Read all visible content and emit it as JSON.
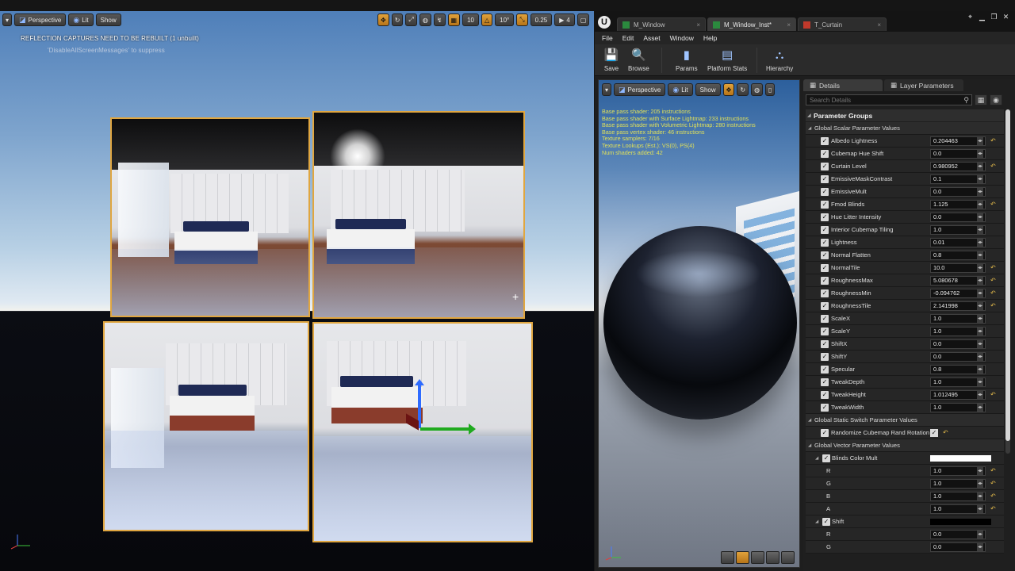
{
  "main_viewport": {
    "toolbar": {
      "view_mode": "Perspective",
      "lit_mode": "Lit",
      "show_label": "Show",
      "grid_snap": "10",
      "rotation_snap": "10°",
      "scale_snap": "0.25",
      "camera_speed": "4"
    },
    "messages": {
      "reflection_warning": "REFLECTION CAPTURES NEED TO BE REBUILT (1 unbuilt)",
      "suppress_hint": "'DisableAllScreenMessages' to suppress"
    }
  },
  "editor": {
    "tabs": [
      {
        "label": "M_Window"
      },
      {
        "label": "M_Window_Inst*"
      },
      {
        "label": "T_Curtain"
      }
    ],
    "menu": [
      "File",
      "Edit",
      "Asset",
      "Window",
      "Help"
    ],
    "toolbar": {
      "save": "Save",
      "browse": "Browse",
      "params": "Params",
      "platform_stats": "Platform Stats",
      "hierarchy": "Hierarchy"
    },
    "preview": {
      "toolbar": {
        "view_mode": "Perspective",
        "lit_mode": "Lit",
        "show_label": "Show"
      },
      "stats": [
        "Base pass shader: 205 instructions",
        "Base pass shader with Surface Lightmap: 233 instructions",
        "Base pass shader with Volumetric Lightmap: 280 instructions",
        "Base pass vertex shader: 46 instructions",
        "Texture samplers: 7/16",
        "Texture Lookups (Est.): VS(0), PS(4)",
        "Num shaders added: 42"
      ]
    },
    "details": {
      "tabs": {
        "details": "Details",
        "layer_parameters": "Layer Parameters"
      },
      "search_placeholder": "Search Details",
      "parameter_groups": "Parameter Groups",
      "scalar_group": "Global Scalar Parameter Values",
      "scalar_params": [
        {
          "name": "Albedo Lightness",
          "value": "0.204463",
          "overridden": true
        },
        {
          "name": "Cubemap Hue Shift",
          "value": "0.0",
          "overridden": false
        },
        {
          "name": "Curtain Level",
          "value": "0.980952",
          "overridden": true
        },
        {
          "name": "EmissiveMaskContrast",
          "value": "0.1",
          "overridden": false
        },
        {
          "name": "EmissiveMult",
          "value": "0.0",
          "overridden": false
        },
        {
          "name": "Fmod Blinds",
          "value": "1.125",
          "overridden": true
        },
        {
          "name": "Hue Litter Intensity",
          "value": "0.0",
          "overridden": false
        },
        {
          "name": "Interior Cubemap Tiling",
          "value": "1.0",
          "overridden": false
        },
        {
          "name": "Lightness",
          "value": "0.01",
          "overridden": false
        },
        {
          "name": "Normal Flatten",
          "value": "0.8",
          "overridden": false
        },
        {
          "name": "NormalTile",
          "value": "10.0",
          "overridden": true
        },
        {
          "name": "RoughnessMax",
          "value": "5.080678",
          "overridden": true
        },
        {
          "name": "RoughnessMin",
          "value": "-0.094762",
          "overridden": true
        },
        {
          "name": "RoughnessTile",
          "value": "2.141998",
          "overridden": true
        },
        {
          "name": "ScaleX",
          "value": "1.0",
          "overridden": false
        },
        {
          "name": "ScaleY",
          "value": "1.0",
          "overridden": false
        },
        {
          "name": "ShiftX",
          "value": "0.0",
          "overridden": false
        },
        {
          "name": "ShiftY",
          "value": "0.0",
          "overridden": false
        },
        {
          "name": "Specular",
          "value": "0.8",
          "overridden": false
        },
        {
          "name": "TweakDepth",
          "value": "1.0",
          "overridden": false
        },
        {
          "name": "TweakHeight",
          "value": "1.012495",
          "overridden": true
        },
        {
          "name": "TweakWidth",
          "value": "1.0",
          "overridden": false
        }
      ],
      "static_switch_group": "Global Static Switch Parameter Values",
      "static_switch_params": [
        {
          "name": "Randomize Cubemap Rand Rotation",
          "checked": true
        }
      ],
      "vector_group": "Global Vector Parameter Values",
      "vector_params": [
        {
          "name": "Blinds Color Mult",
          "color": "#ffffff",
          "channels": [
            {
              "name": "R",
              "value": "1.0"
            },
            {
              "name": "G",
              "value": "1.0"
            },
            {
              "name": "B",
              "value": "1.0"
            },
            {
              "name": "A",
              "value": "1.0"
            }
          ]
        },
        {
          "name": "Shift",
          "color": "#000000",
          "channels": [
            {
              "name": "R",
              "value": "0.0"
            },
            {
              "name": "G",
              "value": "0.0"
            }
          ]
        }
      ]
    }
  }
}
